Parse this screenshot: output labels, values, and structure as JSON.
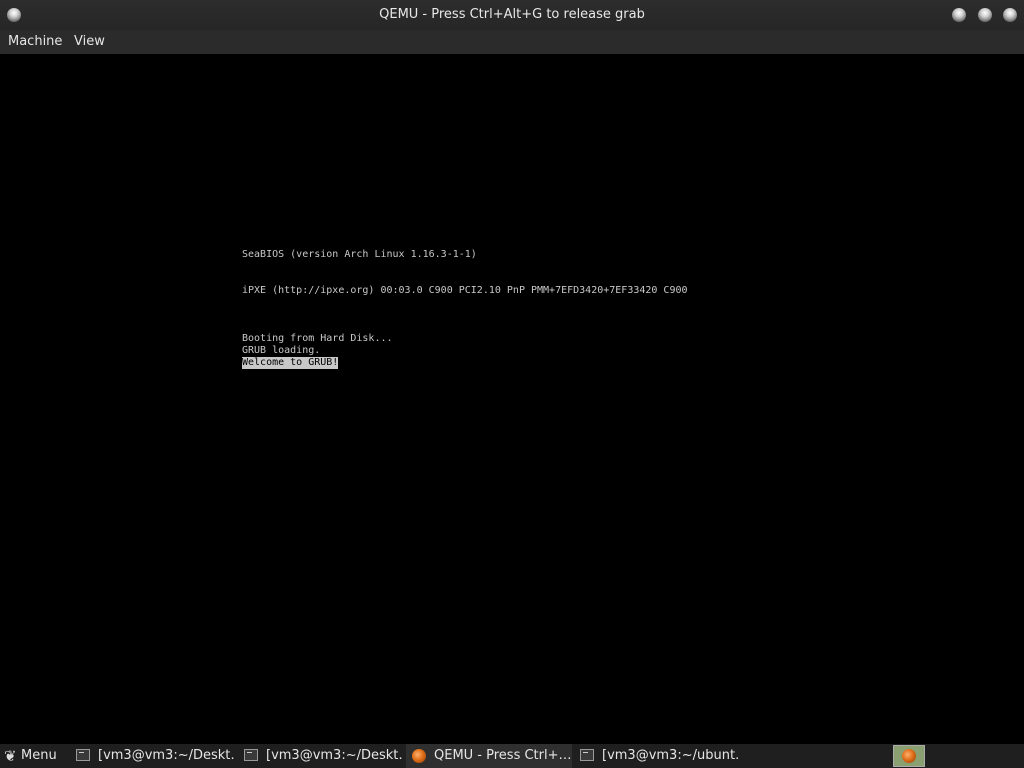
{
  "window": {
    "title": "QEMU - Press Ctrl+Alt+G to release grab"
  },
  "menubar": {
    "items": [
      "Machine",
      "View"
    ]
  },
  "console": {
    "lines": [
      "SeaBIOS (version Arch Linux 1.16.3-1-1)",
      "iPXE (http://ipxe.org) 00:03.0 C900 PCI2.10 PnP PMM+7EFD3420+7EF33420 C900",
      "Booting from Hard Disk...",
      "GRUB loading.",
      "Welcome to GRUB!"
    ]
  },
  "taskbar": {
    "menu_label": "Menu",
    "menu_icon": "gnome-foot-icon",
    "items": [
      {
        "label": "[vm3@vm3:~/Deskt…",
        "icon": "terminal-icon"
      },
      {
        "label": "[vm3@vm3:~/Deskt…",
        "icon": "terminal-icon"
      },
      {
        "label": "QEMU - Press Ctrl+…",
        "icon": "qemu-icon"
      },
      {
        "label": "[vm3@vm3:~/ubunt…",
        "icon": "terminal-icon"
      }
    ],
    "tray_icon": "qemu-icon"
  }
}
